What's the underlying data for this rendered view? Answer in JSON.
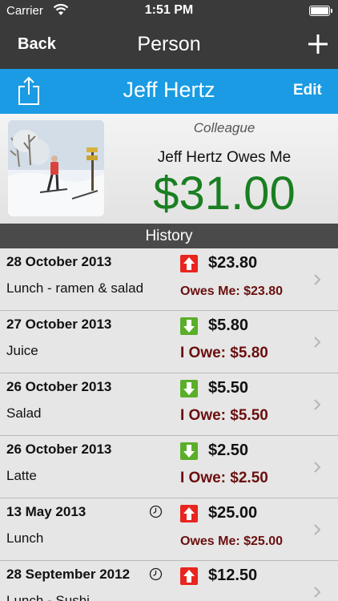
{
  "status_bar": {
    "carrier": "Carrier",
    "time": "1:51 PM"
  },
  "nav": {
    "back_label": "Back",
    "title": "Person"
  },
  "person_bar": {
    "name": "Jeff Hertz",
    "edit_label": "Edit"
  },
  "summary": {
    "relation": "Colleague",
    "owes_label": "Jeff Hertz Owes Me",
    "amount": "$31.00"
  },
  "history": {
    "header": "History",
    "rows": [
      {
        "date": "28 October 2013",
        "desc": "Lunch - ramen & salad",
        "amount": "$23.80",
        "direction": "up",
        "balance": "Owes Me: $23.80",
        "clock": false
      },
      {
        "date": "27 October 2013",
        "desc": "Juice",
        "amount": "$5.80",
        "direction": "down",
        "balance": "I Owe: $5.80",
        "clock": false
      },
      {
        "date": "26 October 2013",
        "desc": "Salad",
        "amount": "$5.50",
        "direction": "down",
        "balance": "I Owe: $5.50",
        "clock": false
      },
      {
        "date": "26 October 2013",
        "desc": "Latte",
        "amount": "$2.50",
        "direction": "down",
        "balance": "I Owe: $2.50",
        "clock": false
      },
      {
        "date": "13 May 2013",
        "desc": "Lunch",
        "amount": "$25.00",
        "direction": "up",
        "balance": "Owes Me: $25.00",
        "clock": true
      },
      {
        "date": "28 September 2012",
        "desc": "Lunch - Sushi",
        "amount": "$12.50",
        "direction": "up",
        "balance": "",
        "clock": true
      }
    ]
  },
  "colors": {
    "accent": "#1a9be3",
    "amount_green": "#1a7f22",
    "balance_red": "#6b0f0f",
    "up_arrow": "#e8251f",
    "down_arrow": "#5aae2a"
  }
}
